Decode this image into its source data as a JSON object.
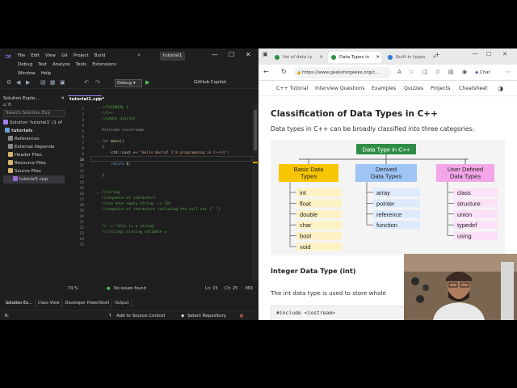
{
  "vs": {
    "menu": [
      "File",
      "Edit",
      "View",
      "Git",
      "Project",
      "Build",
      "Debug",
      "Test",
      "Analyze",
      "Tools",
      "Extensions",
      "Window",
      "Help"
    ],
    "search_icon_label": "⌕",
    "solution_title": "tutorial1",
    "toolbar": {
      "config": "Debug",
      "copilot": "GitHub Copilot"
    },
    "solution_explorer": {
      "header": "Solution Explo...",
      "search_placeholder": "Search Solution Exp",
      "rows": [
        "Solution 'tutorial1' (1 of",
        "tutorials",
        "References",
        "External Depende",
        "Header Files",
        "Resource Files",
        "Source Files",
        "tutorial1.cpp"
      ]
    },
    "editor": {
      "tab": "tutorial1.cpp*",
      "lines": [
        "//TUTORIAL 1",
        "//C++",
        "//eddie digital",
        "",
        "#include <iostream>",
        "",
        "int main()",
        "{",
        "    std::cout << \"Hello World! I'm programming in C++\\n\";",
        "",
        "    return 0;",
        "",
        "}",
        "",
        "",
        "//string",
        "//sequence of characters",
        "//can have empty string --> {0}",
        "//sequence of characters including the null set {\" \"}",
        "",
        "",
        "//--> \"this is a string\"",
        "//(string) strring_variable =",
        "",
        ""
      ],
      "current_line": 10
    },
    "status": {
      "zoom": "74 %",
      "issues": "No issues found",
      "ln": "Ln: 15",
      "ch": "Ch: 25",
      "mix": "MIX"
    },
    "bottom_tabs": [
      "Solution Ex...",
      "Class View",
      "Developer PowerShell",
      "Output"
    ],
    "statusbar": {
      "ready": "R.",
      "source_control": "Add to Source Control",
      "repo": "Select Repository"
    }
  },
  "browser": {
    "tabs": [
      "list of data ty",
      "Data Types in",
      "Built-in types"
    ],
    "active_tab": 1,
    "url": "https://www.geeksforgeeks.org/c...",
    "chat": "Chat",
    "nav": [
      "C++ Tutorial",
      "Interview Questions",
      "Examples",
      "Quizzes",
      "Projects",
      "Cheatsheet"
    ],
    "heading": "Classification of Data Types in C++",
    "intro": "Data types in C++ can be broadly classified into three categories:",
    "diagram": {
      "root": "Data Type in C++",
      "groups": [
        {
          "title": [
            "Basic Data",
            "Types"
          ],
          "items": [
            "int",
            "float",
            "double",
            "char",
            "bool",
            "void"
          ]
        },
        {
          "title": [
            "Derived",
            "Data Types"
          ],
          "items": [
            "array",
            "pointer",
            "reference",
            "function"
          ]
        },
        {
          "title": [
            "User Defined",
            "Data Types"
          ],
          "items": [
            "class",
            "structure",
            "union",
            "typedef",
            "using"
          ]
        }
      ]
    },
    "subheading": "Integer Data Type (int)",
    "para": "The int data type is used to store whole",
    "code": "#include <iostream>"
  },
  "colors": {
    "vs_bg": "#1f1f1f",
    "accent": "#a77cff",
    "gfg_green": "#2f8d46",
    "basic_fill": "#f7c600",
    "derived_fill": "#9ec5f5",
    "user_fill": "#f3a6e8"
  }
}
